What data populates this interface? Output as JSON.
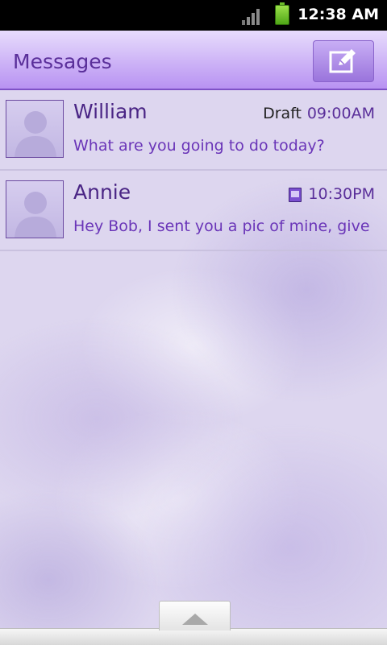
{
  "status": {
    "time": "12:38 AM",
    "signal_icon": "signal-bars-icon",
    "battery_icon": "battery-icon"
  },
  "header": {
    "title": "Messages",
    "compose_icon": "compose-pencil-icon"
  },
  "threads": [
    {
      "name": "William",
      "draft_label": "Draft",
      "time": "09:00AM",
      "snippet": "What are you going to do today?"
    },
    {
      "name": "Annie",
      "attachment_icon": "attachment-icon",
      "time": "10:30PM",
      "snippet": "Hey Bob, I sent you a pic of mine, give ..."
    }
  ],
  "colors": {
    "accent": "#7f52c7",
    "header_top": "#e7dcfc",
    "header_bottom": "#b892f2",
    "text_primary": "#4a2585",
    "text_secondary": "#6a35b8"
  }
}
